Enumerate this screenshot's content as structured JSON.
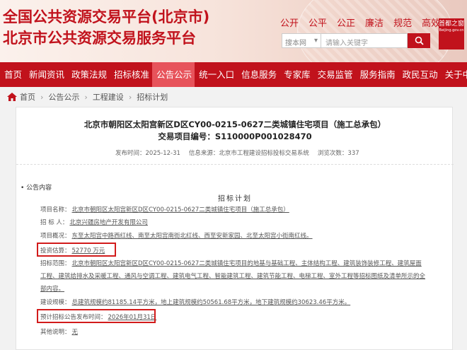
{
  "header": {
    "title_line1": "全国公共资源交易平台(北京市)",
    "title_line2": "北京市公共资源交易服务平台",
    "quick_links": [
      "公开",
      "公平",
      "公正",
      "廉洁",
      "规范",
      "高效"
    ],
    "search": {
      "scope_label": "搜本网",
      "placeholder": "请输入关键字"
    },
    "logo": {
      "text": "首都之窗",
      "sub": "Beijing.gov.cn"
    }
  },
  "nav": {
    "items": [
      "首页",
      "新闻资讯",
      "政策法规",
      "招标核准",
      "公告公示",
      "统一入口",
      "信息服务",
      "专家库",
      "交易监管",
      "服务指南",
      "政民互动",
      "关于中心"
    ],
    "active_index": 4
  },
  "breadcrumb": {
    "items": [
      "首页",
      "公告公示",
      "工程建设",
      "招标计划"
    ]
  },
  "article": {
    "title": "北京市朝阳区太阳宫新区D区CY00-0215-0627二类城镇住宅项目（施工总承包）",
    "code_line": "交易项目编号：S110000P001028470",
    "meta": {
      "publish_time": "发布时间：2025-12-31",
      "source": "信息来源：北京市工程建设招标投标交易系统",
      "views": "浏览次数：337"
    },
    "section_label": "公告内容",
    "plan_heading": "招标计划",
    "fields": {
      "project_name": {
        "label": "项目名称：",
        "value": "北京市朝阳区太阳宫新区D区CY00-0215-0627二类城镇住宅项目（施工总承包）"
      },
      "tenderer": {
        "label": "招 标 人：",
        "value": "北京兴疆房地产开发有限公司"
      },
      "overview": {
        "label": "项目概况：",
        "value": "东至太阳宫中路西红线、南至太阳宫南街北红线、西至安新家园、北至太阳宫小街南红线。"
      },
      "investment": {
        "label": "投资估算：",
        "value": "52770 万元"
      },
      "scope": {
        "label": "招标范围：",
        "value": "北京市朝阳区太阳宫新区D区CY00-0215-0627二类城镇住宅项目的地基与基础工程、主体结构工程、建筑装饰装修工程、建筑屋面工程、建筑给排水及采暖工程、通风与空调工程、建筑电气工程、智能建筑工程、建筑节能工程、电梯工程、室外工程等招标图纸及清单所示的全部内容。"
      },
      "scale": {
        "label": "建设规模：",
        "value": "总建筑规模约81185.14平方米，地上建筑规模约50561.68平方米，地下建筑规模约30623.46平方米。"
      },
      "announce_time": {
        "label": "预计招标公告发布时间：",
        "value": "2026年01月31日"
      },
      "other": {
        "label": "其他说明：",
        "value": "无"
      }
    }
  },
  "colors": {
    "brand_red": "#c1121c",
    "nav_active": "#e7535b",
    "highlight_box": "#d21b1b"
  }
}
